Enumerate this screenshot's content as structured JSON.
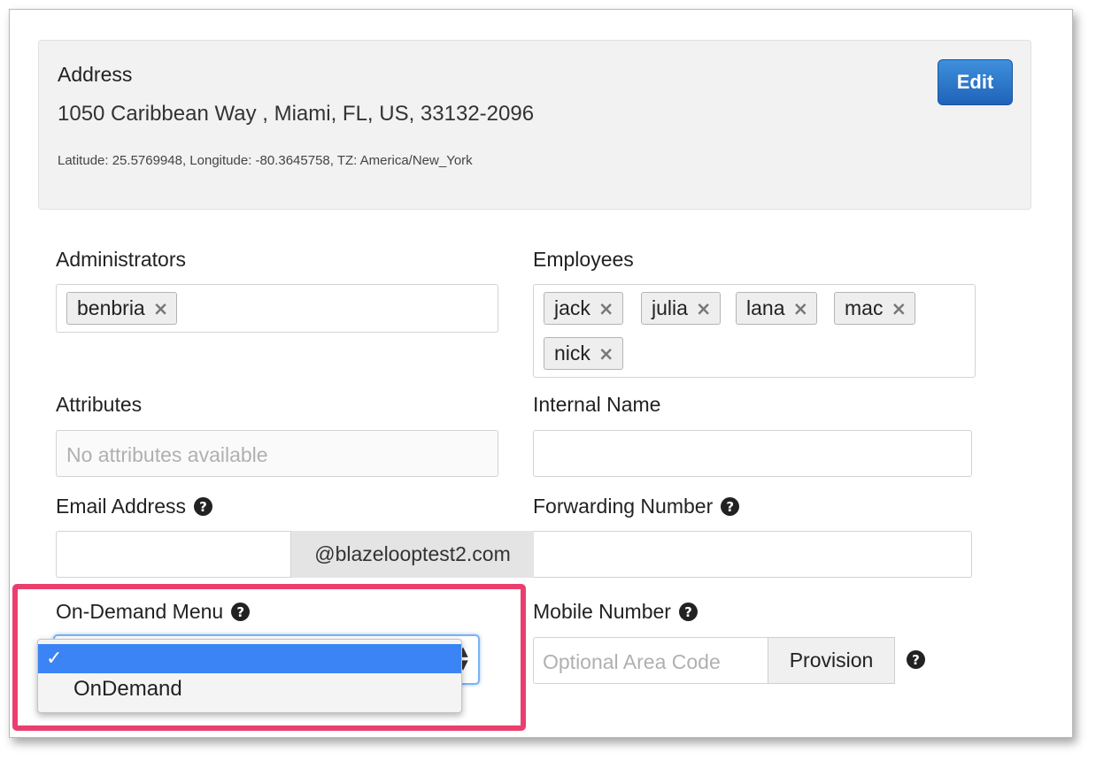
{
  "address": {
    "title": "Address",
    "line": "1050 Caribbean Way , Miami, FL, US, 33132-2096",
    "meta": "Latitude: 25.5769948, Longitude: -80.3645758, TZ: America/New_York",
    "edit_label": "Edit"
  },
  "administrators": {
    "label": "Administrators",
    "tags": [
      "benbria"
    ]
  },
  "employees": {
    "label": "Employees",
    "tags": [
      "jack",
      "julia",
      "lana",
      "mac",
      "nick"
    ]
  },
  "attributes": {
    "label": "Attributes",
    "placeholder": "No attributes available"
  },
  "internal_name": {
    "label": "Internal Name",
    "value": ""
  },
  "email": {
    "label": "Email Address",
    "value": "",
    "domain": "@blazelooptest2.com"
  },
  "forwarding_number": {
    "label": "Forwarding Number",
    "value": ""
  },
  "on_demand_menu": {
    "label": "On-Demand Menu",
    "selected": "",
    "checkmark": "✓",
    "options": [
      "",
      "OnDemand"
    ]
  },
  "mobile_number": {
    "label": "Mobile Number",
    "placeholder": "Optional Area Code",
    "provision_label": "Provision"
  },
  "icons": {
    "help": "?",
    "tag_remove": "×",
    "select_up": "▲",
    "select_down": "▼"
  },
  "colors": {
    "highlight": "#ea3f6e",
    "edit_button": "#2a74c9",
    "dropdown_selected": "#3b84f5"
  }
}
